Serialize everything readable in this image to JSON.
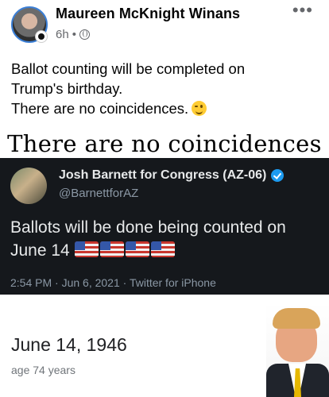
{
  "post": {
    "author": "Maureen McKnight Winans",
    "time": "6h",
    "separator": "•",
    "privacy_icon": "globe-icon",
    "more_icon": "more-options-icon",
    "text_line1": "Ballot counting will be completed on",
    "text_line2": "Trump's birthday.",
    "text_line3": "There are no coincidences.",
    "emoji": "winking-face-emoji"
  },
  "caption": "There are no coincidences",
  "tweet": {
    "name": "Josh Barnett for Congress (AZ-06)",
    "handle": "@BarnettforAZ",
    "text_line1": "Ballots will be done being counted on",
    "text_line2": "June 14",
    "flag_count": 4,
    "meta": "2:54 PM · Jun 6, 2021 · Twitter for iPhone",
    "colors": {
      "background": "#15181c",
      "verified": "#1d9bf0"
    }
  },
  "google_card": {
    "date": "June 14, 1946",
    "age": "age 74 years"
  }
}
